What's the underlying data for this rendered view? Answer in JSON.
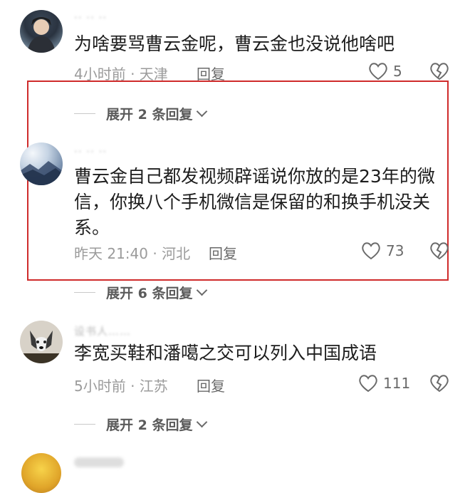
{
  "comments": [
    {
      "username": "·· ·· ··",
      "text": "为啥要骂曹云金呢，曹云金也没说他啥吧",
      "meta": "4小时前 · 天津",
      "reply_label": "回复",
      "likes": "5"
    },
    {
      "username": "·· ·· ··",
      "text": "曹云金自己都发视频辟谣说你放的是23年的微信，你换八个手机微信是保留的和换手机没关系。",
      "meta": "昨天 21:40 · 河北",
      "reply_label": "回复",
      "likes": "73",
      "highlighted": true
    },
    {
      "username": "设书人……",
      "text": "李宽买鞋和潘噶之交可以列入中国成语",
      "meta": "5小时前 · 江苏",
      "reply_label": "回复",
      "likes": "111"
    }
  ],
  "expanders": [
    {
      "label": "展开 2 条回复"
    },
    {
      "label": "展开 6 条回复"
    },
    {
      "label": "展开 2 条回复"
    }
  ],
  "colors": {
    "highlight_border": "#cf2b2b",
    "meta_text": "#9b9b9b",
    "comment_text": "#1d1d1d"
  }
}
